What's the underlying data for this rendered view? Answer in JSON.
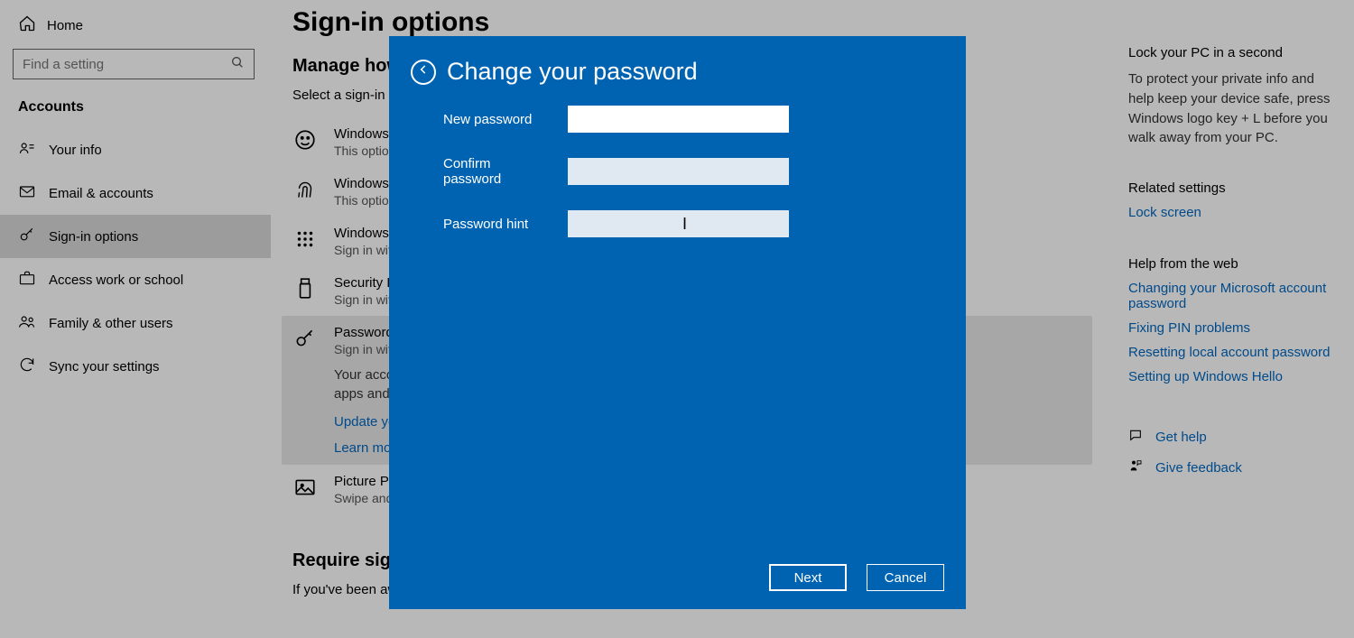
{
  "sidebar": {
    "home": "Home",
    "search_placeholder": "Find a setting",
    "section": "Accounts",
    "items": [
      {
        "label": "Your info"
      },
      {
        "label": "Email & accounts"
      },
      {
        "label": "Sign-in options"
      },
      {
        "label": "Access work or school"
      },
      {
        "label": "Family & other users"
      },
      {
        "label": "Sync your settings"
      }
    ]
  },
  "main": {
    "page_title": "Sign-in options",
    "manage_heading": "Manage how",
    "select_prompt": "Select a sign-in op",
    "options": [
      {
        "title": "Windows H",
        "desc": "This optio"
      },
      {
        "title": "Windows H",
        "desc": "This optio"
      },
      {
        "title": "Windows H",
        "desc": "Sign in wit"
      },
      {
        "title": "Security Ke",
        "desc": "Sign in wit"
      },
      {
        "title": "Password",
        "desc": "Sign in wit",
        "extra": "Your accou\napps and s",
        "link1": "Update yo",
        "link2": "Learn more"
      },
      {
        "title": "Picture Pass",
        "desc": "Swipe and"
      }
    ],
    "require_title": "Require sign-",
    "require_body": "If you've been away, when should Windows require you to sign in again?"
  },
  "right": {
    "lock_title": "Lock your PC in a second",
    "lock_body": "To protect your private info and help keep your device safe, press Windows logo key + L before you walk away from your PC.",
    "related_title": "Related settings",
    "related_link": "Lock screen",
    "help_title": "Help from the web",
    "help_links": [
      "Changing your Microsoft account password",
      "Fixing PIN problems",
      "Resetting local account password",
      "Setting up Windows Hello"
    ],
    "get_help": "Get help",
    "give_feedback": "Give feedback"
  },
  "modal": {
    "title": "Change your password",
    "new_password_label": "New password",
    "confirm_password_label": "Confirm password",
    "hint_label": "Password hint",
    "new_password_value": "",
    "confirm_password_value": "",
    "hint_value": "",
    "next": "Next",
    "cancel": "Cancel"
  }
}
